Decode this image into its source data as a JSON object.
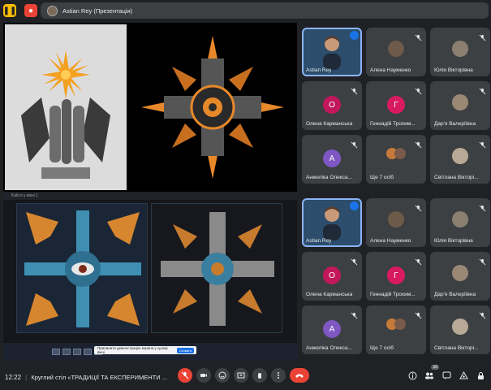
{
  "header": {
    "presenter_label": "Astian Rey (Презентація)"
  },
  "screen_share": {
    "window_title": "Kalico у вікні 1",
    "notification_text": "Припинити демонстрацію екрана у цьому вікні",
    "notification_button": "Сховати"
  },
  "participants": [
    {
      "name": "Astian Rey",
      "type": "video",
      "speaking": true
    },
    {
      "name": "Алена Науменко",
      "type": "photo",
      "color": "#6d5a48"
    },
    {
      "name": "Юлія Вікторівна",
      "type": "photo",
      "color": "#8a7f70"
    },
    {
      "name": "Олена Карманська",
      "type": "letter",
      "letter": "О",
      "color": "#c2185b"
    },
    {
      "name": "Геннадій Трохим...",
      "type": "letter",
      "letter": "Г",
      "color": "#d81b60"
    },
    {
      "name": "Дар'я Валеріївна",
      "type": "photo",
      "color": "#9a8774"
    },
    {
      "name": "Анжеліка Олекса...",
      "type": "letter",
      "letter": "А",
      "color": "#7e57c2"
    },
    {
      "name": "Ще 7 осіб",
      "type": "more"
    },
    {
      "name": "Світлана Вікторі...",
      "type": "photo",
      "color": "#b7a996"
    }
  ],
  "participants_repeat": [
    {
      "name": "Astian Rey"
    },
    {
      "name": "Алена Науменко"
    },
    {
      "name": "Юлія Вікторівна"
    },
    {
      "name": "Олена Карманська",
      "letter": "О"
    },
    {
      "name": "Геннадій Трохим...",
      "letter": "Г"
    },
    {
      "name": "Дар'я Валеріївна"
    },
    {
      "name": "Анжеліка Олекса...",
      "letter": "А"
    },
    {
      "name": "Ще 7 осіб"
    },
    {
      "name": "Світлана Вікторі..."
    }
  ],
  "footer": {
    "time": "12:22",
    "meeting_title": "Круглий стіл «ТРАДИЦІЇ ТА ЕКСПЕРИМЕНТИ ...",
    "participants_count": "16"
  },
  "colors": {
    "background": "#202124",
    "tile": "#3c4043",
    "accent": "#8ab4f8",
    "danger": "#ea4335"
  },
  "icons": [
    "mic-off-icon",
    "camera-icon",
    "emoji-icon",
    "present-icon",
    "hand-icon",
    "more-icon",
    "end-call-icon",
    "info-icon",
    "people-icon",
    "chat-icon",
    "activities-icon",
    "lock-icon"
  ]
}
